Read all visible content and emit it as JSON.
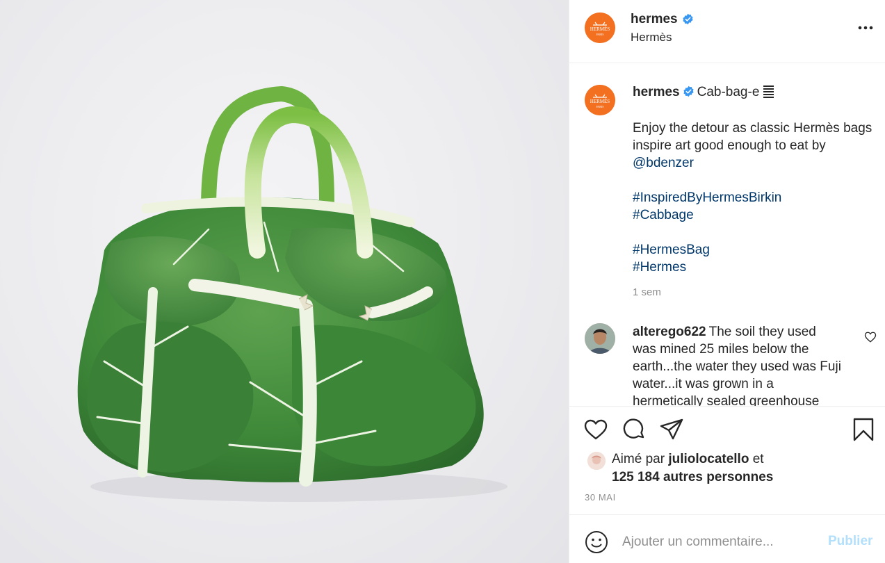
{
  "media": {
    "alt_subject": "cabbage-leaf-birkin-bag-photo"
  },
  "header": {
    "username": "hermes",
    "subname": "Hermès",
    "avatar_text": "HERMÈS",
    "avatar_subtext": "PARIS",
    "more_icon": "more-horizontal-icon"
  },
  "caption": {
    "username": "hermes",
    "title": "Cab-bag-e",
    "text_line1": "Enjoy the detour as classic Hermès bags inspire art good enough to eat by ",
    "mention": "@bdenzer",
    "hashtag1": "#InspiredByHermesBirkin",
    "hashtag2": "#Cabbage",
    "hashtag3": "#HermesBag",
    "hashtag4": "#Hermes",
    "time_ago": "1 sem"
  },
  "comment": {
    "username": "alterego622",
    "text": "The soil they used was mined 25 miles below the earth...the water they used was Fuji water...it was grown in a hermetically sealed greenhouse"
  },
  "actions": {
    "like_icon": "heart-icon",
    "comment_icon": "comment-bubble-icon",
    "share_icon": "paper-plane-icon",
    "save_icon": "bookmark-icon"
  },
  "likes": {
    "prefix": "Aimé par ",
    "user": "juliolocatello",
    "middle": " et",
    "count_text": "125 184 autres personnes"
  },
  "date": "30 MAI",
  "comment_box": {
    "placeholder": "Ajouter un commentaire...",
    "publish_label": "Publier"
  },
  "colors": {
    "brand_orange": "#f37021",
    "verified_blue": "#3897f0",
    "link_blue": "#00376b",
    "publish_disabled": "#b2dffc",
    "leaf_green": "#3f8a3a"
  }
}
